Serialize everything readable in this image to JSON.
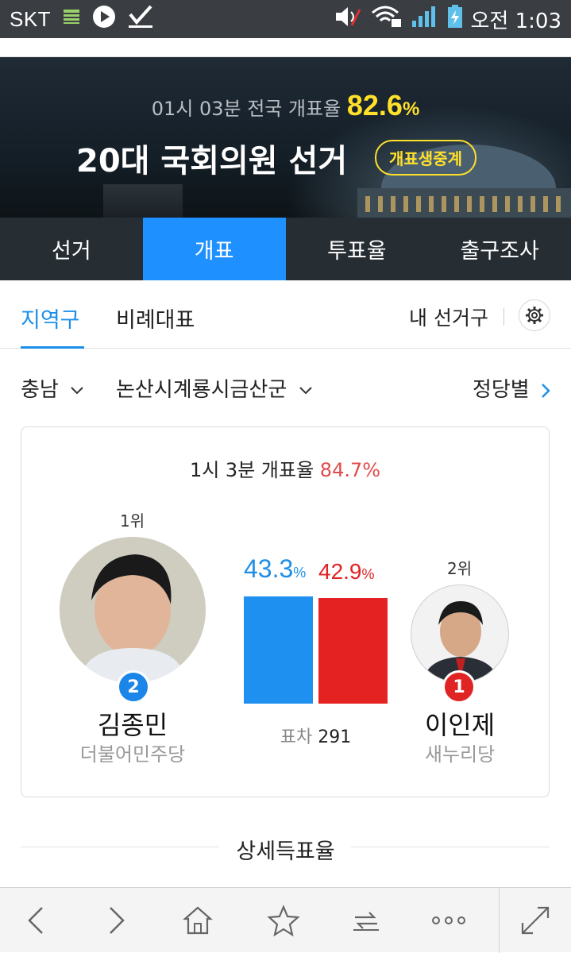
{
  "status_bar": {
    "carrier": "SKT",
    "time": "오전 1:03"
  },
  "hero": {
    "time_prefix": "01시 03분 전국 개표율",
    "national_rate": "82.6",
    "rate_unit": "%",
    "title": "20대 국회의원 선거",
    "live_badge": "개표생중계"
  },
  "tabs": [
    {
      "label": "선거",
      "active": false
    },
    {
      "label": "개표",
      "active": true
    },
    {
      "label": "투표율",
      "active": false
    },
    {
      "label": "출구조사",
      "active": false
    }
  ],
  "subtabs": {
    "district": "지역구",
    "proportional": "비례대표",
    "my_district": "내 선거구"
  },
  "filters": {
    "province": "충남",
    "district": "논산시계룡시금산군",
    "by_party": "정당별"
  },
  "result": {
    "header_prefix": "1시 3분 개표율",
    "header_rate": "84.7%",
    "candidate1": {
      "rank": "1위",
      "number": "2",
      "name": "김종민",
      "party": "더불어민주당",
      "pct": 43.3,
      "pct_text": "43.3",
      "color": "#1e90f0"
    },
    "candidate2": {
      "rank": "2위",
      "number": "1",
      "name": "이인제",
      "party": "새누리당",
      "pct": 42.9,
      "pct_text": "42.9",
      "color": "#e52222"
    },
    "pct_unit": "%",
    "diff_label": "표차",
    "diff_value": "291"
  },
  "detail": {
    "title": "상세득표율"
  },
  "bottom_bar": {
    "icons": [
      "back-icon",
      "forward-icon",
      "home-icon",
      "bookmark-star-icon",
      "tabs-switch-icon",
      "more-icon",
      "fullscreen-icon"
    ]
  }
}
